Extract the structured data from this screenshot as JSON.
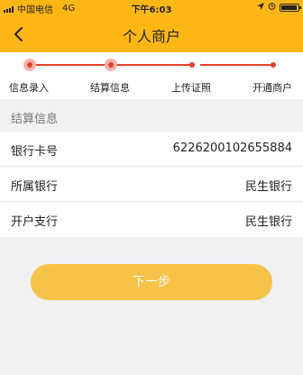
{
  "status_bar": {
    "carrier": "中国电信",
    "network": "4G",
    "time": "下午6:03"
  },
  "header": {
    "title": "个人商户"
  },
  "steps": [
    {
      "label": "信息录入"
    },
    {
      "label": "结算信息"
    },
    {
      "label": "上传证照"
    },
    {
      "label": "开通商户"
    }
  ],
  "section": {
    "title": "结算信息"
  },
  "form": {
    "rows": [
      {
        "label": "银行卡号",
        "value": "6226200102655884"
      },
      {
        "label": "所属银行",
        "value": "民生银行"
      },
      {
        "label": "开户支行",
        "value": "民生银行"
      }
    ]
  },
  "actions": {
    "next_label": "下一步"
  },
  "colors": {
    "header": "#ffb714",
    "progress": "#e2412a",
    "button": "#f7c248"
  }
}
